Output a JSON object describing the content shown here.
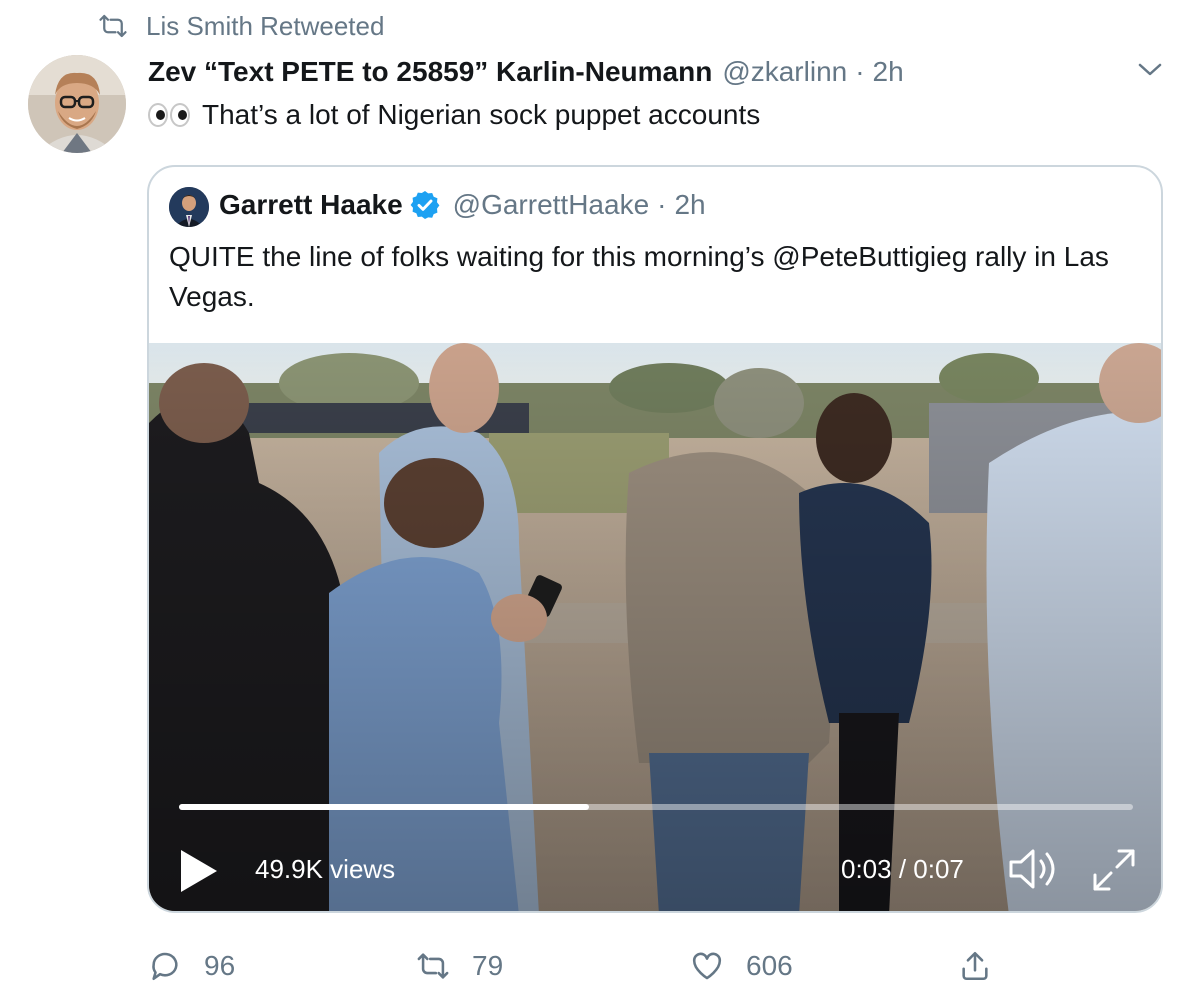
{
  "retweet_banner": {
    "text": "Lis Smith Retweeted",
    "icon": "retweet-icon"
  },
  "tweet": {
    "author_name": "Zev “Text PETE to 25859” Karlin-Neumann",
    "handle": "@zkarlinn",
    "separator": "·",
    "time": "2h",
    "emoji": "eyes-emoji",
    "text": "That’s a lot of Nigerian sock puppet accounts"
  },
  "quoted_tweet": {
    "author_name": "Garrett Haake",
    "verified": true,
    "handle": "@GarrettHaake",
    "separator": "·",
    "time": "2h",
    "text": "QUITE the line of folks waiting for this morning’s @PeteButtigieg rally in Las Vegas."
  },
  "video": {
    "views": "49.9K views",
    "time_display": "0:03 / 0:07",
    "progress_fraction": 0.43
  },
  "actions": {
    "replies": "96",
    "retweets": "79",
    "likes": "606"
  },
  "colors": {
    "muted": "#657786",
    "verified": "#1da1f2",
    "border": "#ccd6dd"
  }
}
